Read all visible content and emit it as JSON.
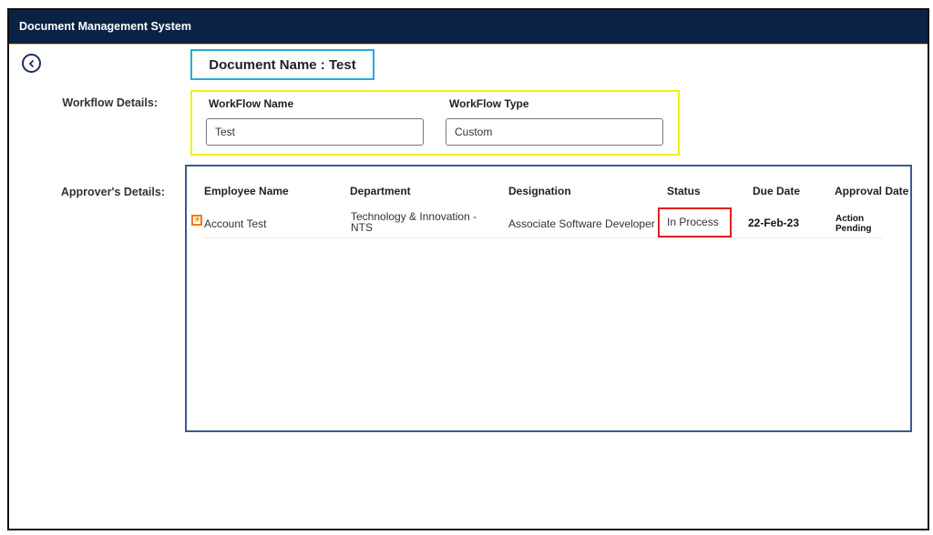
{
  "app": {
    "title": "Document Management System"
  },
  "navigation": {
    "back_icon": "chevron-left-circle-icon"
  },
  "document": {
    "name_label": "Document Name : Test"
  },
  "workflow": {
    "section_label": "Workflow Details:",
    "name_label": "WorkFlow Name",
    "name_value": "Test",
    "type_label": "WorkFlow Type",
    "type_value": "Custom"
  },
  "approvers": {
    "section_label": "Approver's Details:",
    "columns": [
      "Employee Name",
      "Department",
      "Designation",
      "Status",
      "Due Date",
      "Approval Date"
    ],
    "rows": [
      {
        "marker_icon": "star-icon",
        "employee_name": "Account Test",
        "department_line1": "Technology & Innovation -",
        "department_line2": "NTS",
        "designation": "Associate Software Developer",
        "status": "In Process",
        "due_date": "22-Feb-23",
        "approval_date_line1": "Action",
        "approval_date_line2": "Pending"
      }
    ]
  },
  "colors": {
    "header_bg": "#0a2344",
    "docname_border": "#29a9d9",
    "workflow_border": "#f2ef14",
    "approver_border": "#3c5a93",
    "status_border": "#e01f1f",
    "star_border": "#f07a22"
  }
}
